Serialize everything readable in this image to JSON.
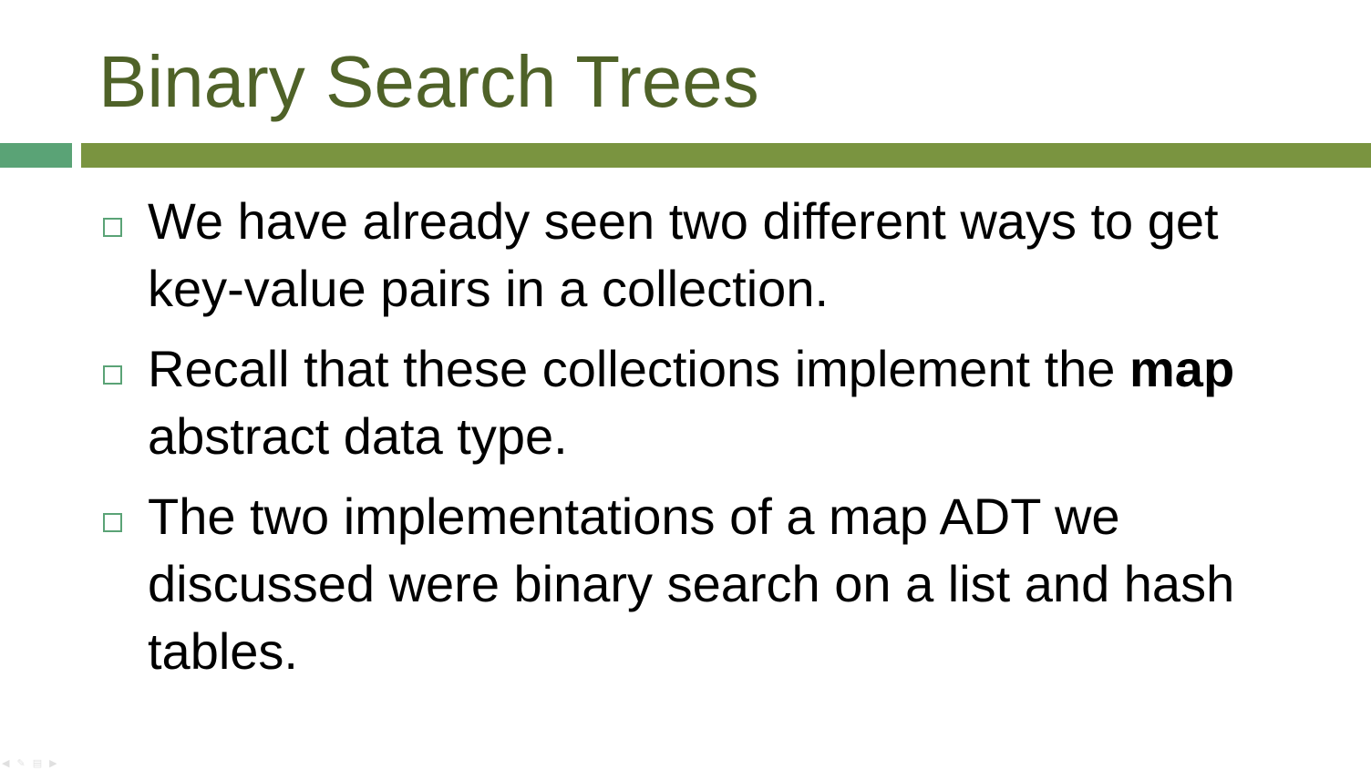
{
  "slide": {
    "title": "Binary Search Trees",
    "bullets": [
      {
        "text": "We have already seen two different ways to get key-value pairs in a collection."
      },
      {
        "before": "Recall that these collections implement the ",
        "bold": "map",
        "after": " abstract data type."
      },
      {
        "text": "The two implementations of a map ADT we discussed were binary search on a list and hash tables."
      }
    ]
  },
  "colors": {
    "title": "#4f6228",
    "accent_left": "#5aa376",
    "accent_right": "#7a9440",
    "bullet_marker": "#5aa376"
  },
  "icons": {
    "bullet_marker": "hollow-square",
    "nav_back": "arrow-left-icon",
    "nav_pen": "pen-icon",
    "nav_slides": "slides-icon",
    "nav_forward": "arrow-right-icon"
  }
}
